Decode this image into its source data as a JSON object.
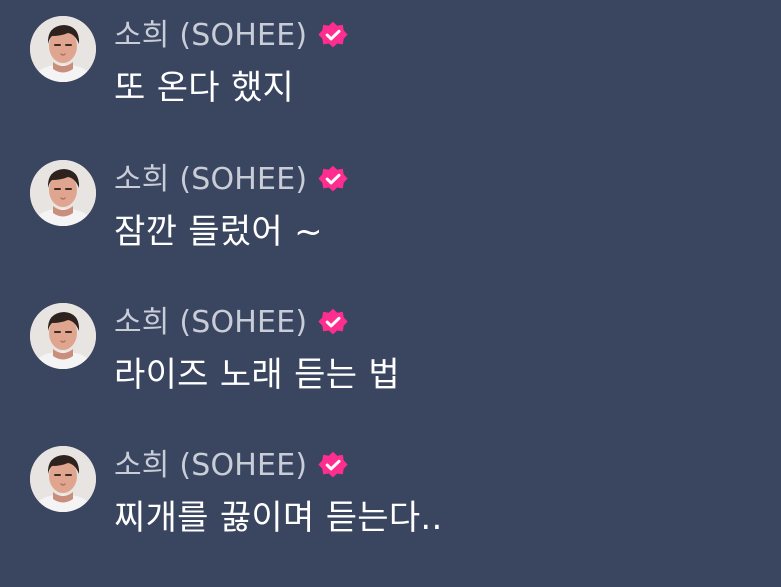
{
  "colors": {
    "background": "#3a4560",
    "sender_name": "#c8cdd8",
    "message_text": "#ffffff",
    "verified_badge": "#ff2d8f"
  },
  "messages": [
    {
      "sender": "소희 (SOHEE)",
      "text": "또 온다 했지",
      "avatar_icon": "profile-photo",
      "verified_icon": "verified-badge-icon"
    },
    {
      "sender": "소희 (SOHEE)",
      "text": "잠깐 들렀어 ~",
      "avatar_icon": "profile-photo",
      "verified_icon": "verified-badge-icon"
    },
    {
      "sender": "소희 (SOHEE)",
      "text": "라이즈 노래 듣는 법",
      "avatar_icon": "profile-photo",
      "verified_icon": "verified-badge-icon"
    },
    {
      "sender": "소희 (SOHEE)",
      "text": "찌개를 끓이며 듣는다..",
      "avatar_icon": "profile-photo",
      "verified_icon": "verified-badge-icon"
    }
  ]
}
